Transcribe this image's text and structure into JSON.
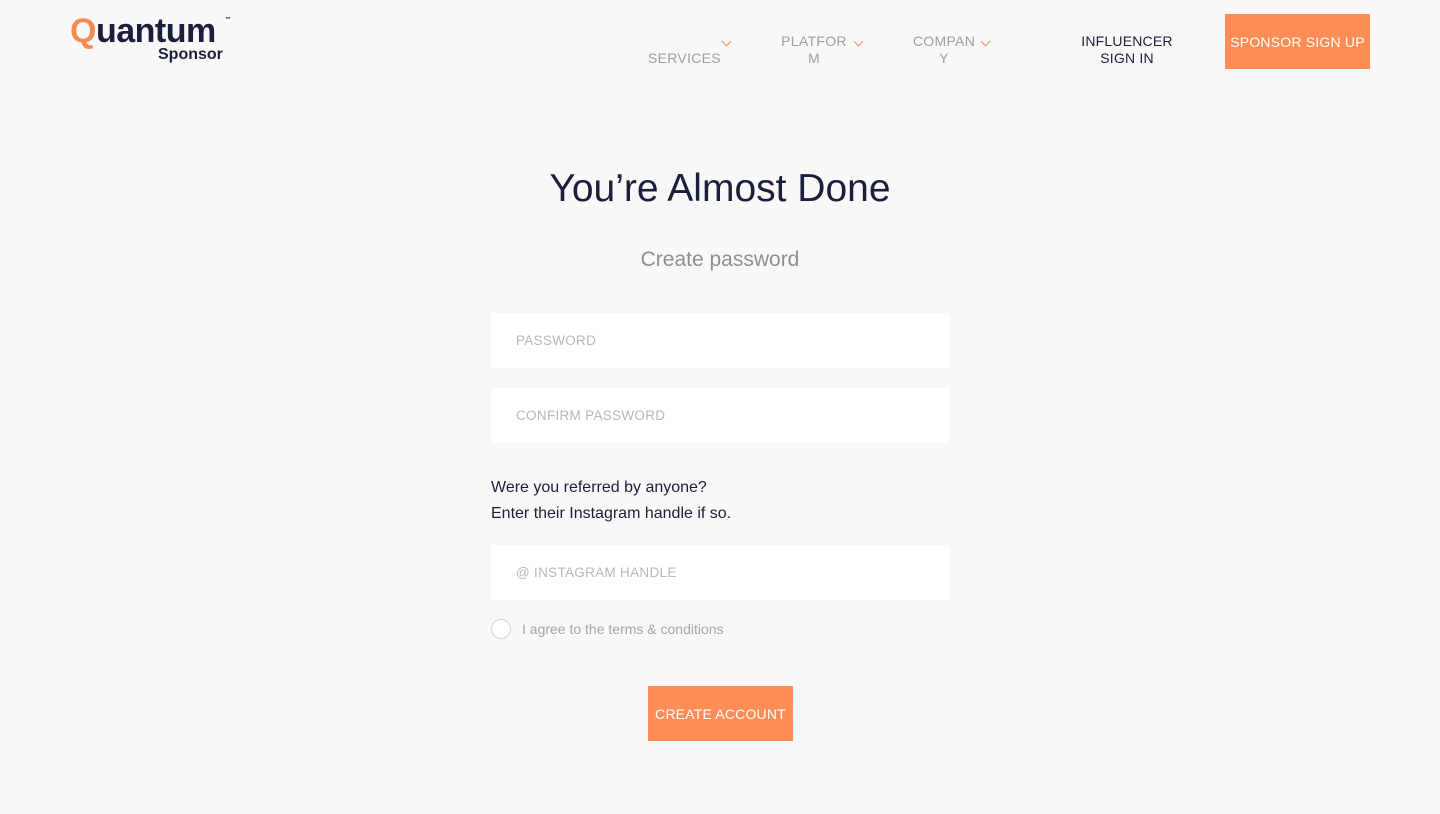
{
  "brand": {
    "name_first": "Q",
    "name_rest": "uantum",
    "tm": "™",
    "sub": "Sponsor"
  },
  "nav": {
    "items": [
      {
        "label": "SERVICES",
        "icon": "chevron-down-icon"
      },
      {
        "label": "PLATFORM",
        "icon": "chevron-down-icon"
      },
      {
        "label": "COMPANY",
        "icon": "chevron-down-icon"
      }
    ],
    "influencer_sign_in": "INFLUENCER SIGN IN",
    "sponsor_sign_up": "SPONSOR SIGN UP"
  },
  "main": {
    "title": "You’re Almost Done",
    "subtitle": "Create password",
    "password": {
      "placeholder": "PASSWORD",
      "value": ""
    },
    "confirm_password": {
      "placeholder": "CONFIRM PASSWORD",
      "value": ""
    },
    "referral_line1": "Were you referred by anyone?",
    "referral_line2": "Enter their Instagram handle if so.",
    "instagram": {
      "placeholder": "@ INSTAGRAM HANDLE",
      "value": ""
    },
    "terms_label": "I agree to the terms & conditions",
    "terms_checked": false,
    "create_button": "CREATE ACCOUNT"
  },
  "colors": {
    "accent": "#ff8d55",
    "brand_dark": "#1b1f3b",
    "background": "#f8f8f8"
  }
}
